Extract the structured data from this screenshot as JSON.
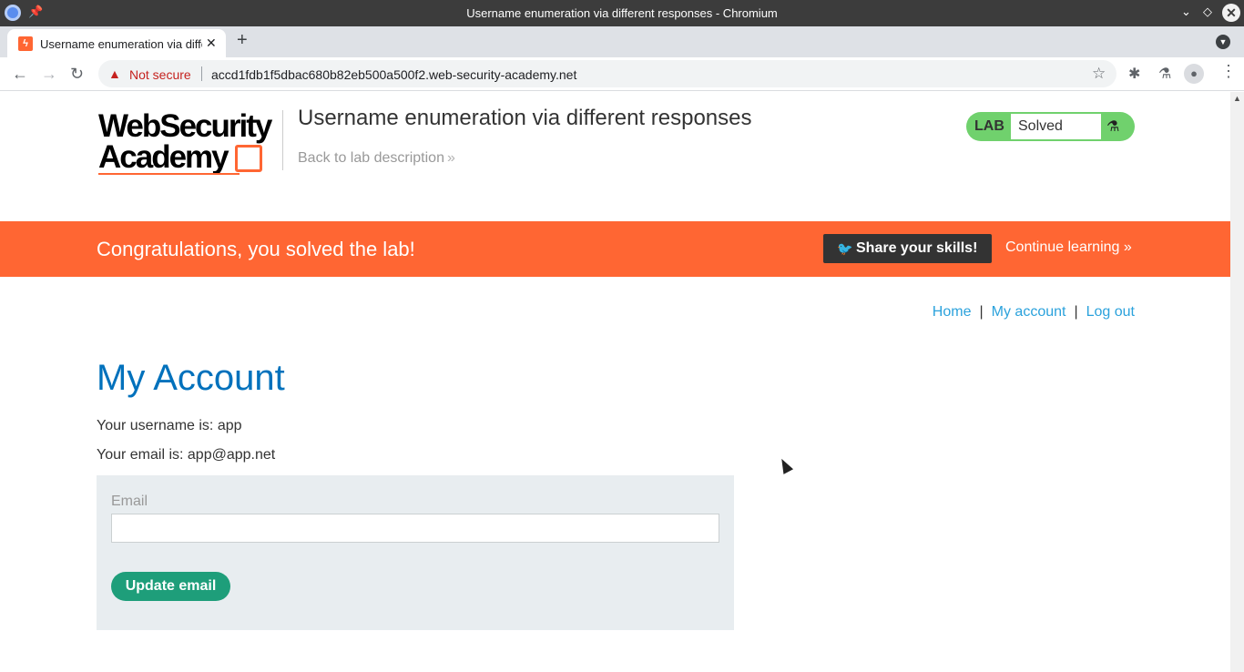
{
  "window": {
    "title": "Username enumeration via different responses - Chromium",
    "controls": {
      "minimize": "⌄",
      "maximize": "◇",
      "close": "✕"
    }
  },
  "tabs": [
    {
      "title": "Username enumeration via different responses",
      "favicon": "bolt-icon",
      "close": "✕"
    }
  ],
  "toolbar": {
    "new_tab": "+",
    "back": "←",
    "forward": "→",
    "reload": "↻",
    "security_label": "Not secure",
    "url": "accd1fdb1f5dbac680b82eb500a500f2.web-security-academy.net",
    "icons": [
      "star-icon",
      "extensions-icon",
      "labs-flask-icon",
      "profile-icon",
      "menu-icon"
    ]
  },
  "header": {
    "logo_line1": "WebSecurity",
    "logo_line2": "Academy",
    "lab_title": "Username enumeration via different responses",
    "back_link": "Back to lab description",
    "lab_tag": "LAB",
    "lab_status": "Solved"
  },
  "banner": {
    "message": "Congratulations, you solved the lab!",
    "share_label": "Share your skills!",
    "continue_label": "Continue learning",
    "color": "#ff6633"
  },
  "nav": {
    "home": "Home",
    "my_account": "My account",
    "log_out": "Log out",
    "separator": "|"
  },
  "account": {
    "heading": "My Account",
    "username_line": "Your username is: app",
    "email_line": "Your email is: app@app.net",
    "email_label": "Email",
    "email_value": "",
    "update_button": "Update email"
  },
  "colors": {
    "accent_blue": "#0071bc",
    "link_blue": "#2ba2dc",
    "button_green": "#1e9e7a",
    "status_green": "#70d16d"
  }
}
